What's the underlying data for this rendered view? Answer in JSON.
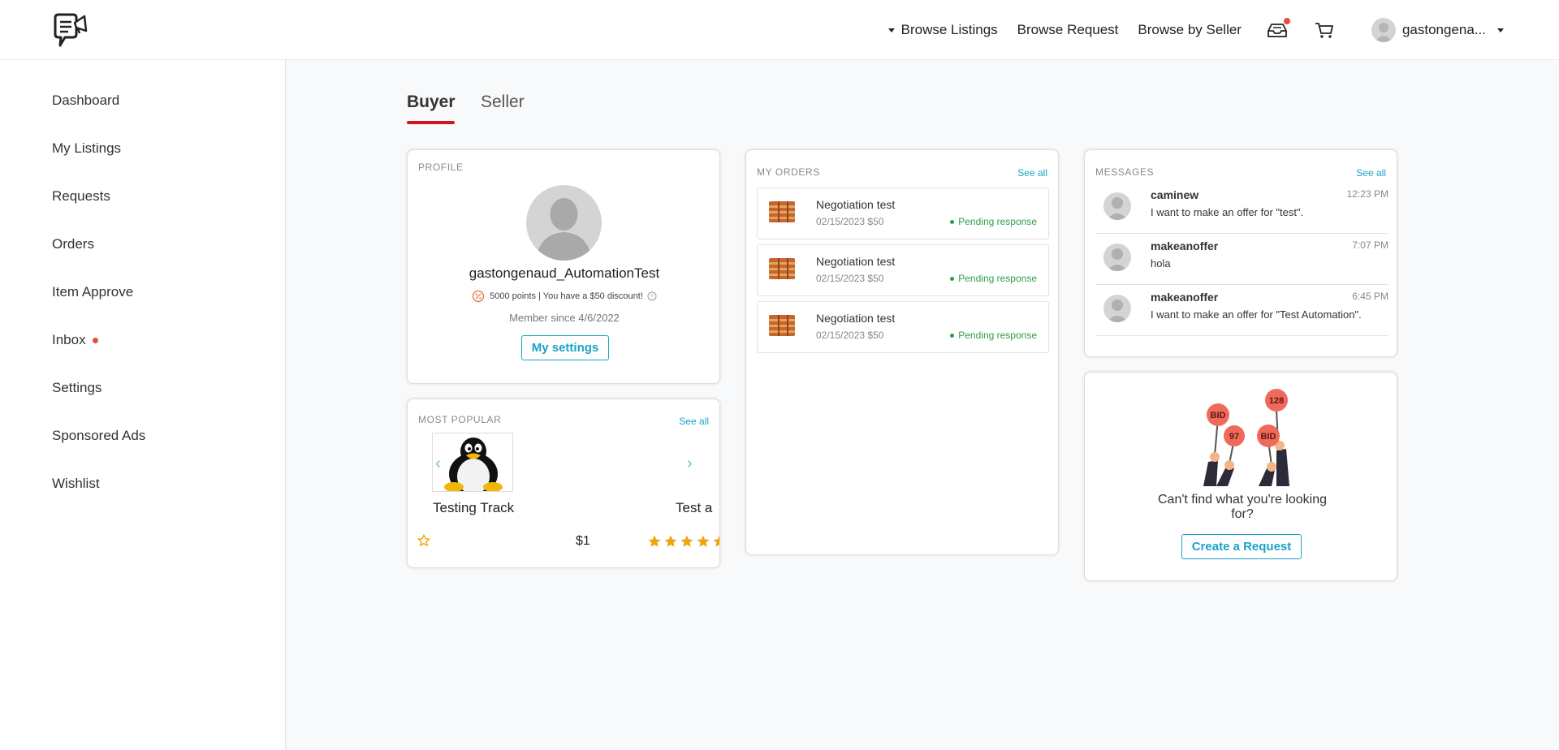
{
  "nav": {
    "browse_listings": "Browse Listings",
    "browse_request": "Browse Request",
    "browse_by_seller": "Browse by Seller",
    "user_name": "gastongena..."
  },
  "sidebar": {
    "items": [
      {
        "label": "Dashboard"
      },
      {
        "label": "My Listings"
      },
      {
        "label": "Requests"
      },
      {
        "label": "Orders"
      },
      {
        "label": "Item Approve"
      },
      {
        "label": "Inbox"
      },
      {
        "label": "Settings"
      },
      {
        "label": "Sponsored Ads"
      },
      {
        "label": "Wishlist"
      }
    ]
  },
  "tabs": {
    "buyer": "Buyer",
    "seller": "Seller"
  },
  "profile": {
    "title": "PROFILE",
    "username": "gastongenaud_AutomationTest",
    "points": "5000 points | You have a $50 discount!",
    "member_since": "Member since 4/6/2022",
    "settings_button": "My settings"
  },
  "popular": {
    "title": "MOST POPULAR",
    "see_all": "See all",
    "item1_title": "Testing Track",
    "item1_price": "$1",
    "item2_title": "Test a"
  },
  "orders": {
    "title": "MY ORDERS",
    "see_all": "See all",
    "rows": [
      {
        "title": "Negotiation test",
        "meta": "02/15/2023 $50",
        "status": "Pending response"
      },
      {
        "title": "Negotiation test",
        "meta": "02/15/2023 $50",
        "status": "Pending response"
      },
      {
        "title": "Negotiation test",
        "meta": "02/15/2023 $50",
        "status": "Pending response"
      }
    ]
  },
  "messages": {
    "title": "MESSAGES",
    "see_all": "See all",
    "rows": [
      {
        "name": "caminew",
        "text": "I want to make an offer for \"test\".",
        "time": "12:23 PM"
      },
      {
        "name": "makeanoffer",
        "text": "hola",
        "time": "7:07 PM"
      },
      {
        "name": "makeanoffer",
        "text": "I want to make an offer for \"Test Automation\".",
        "time": "6:45 PM"
      }
    ]
  },
  "request_cta": {
    "text": "Can't find what you're looking for?",
    "button": "Create a Request",
    "sign_labels": [
      "BID",
      "97",
      "BID",
      "128"
    ]
  },
  "colors": {
    "accent": "#1aa3c7",
    "brand_red": "#d0171f",
    "status_green": "#2e9e47",
    "star": "#f0a30a"
  }
}
